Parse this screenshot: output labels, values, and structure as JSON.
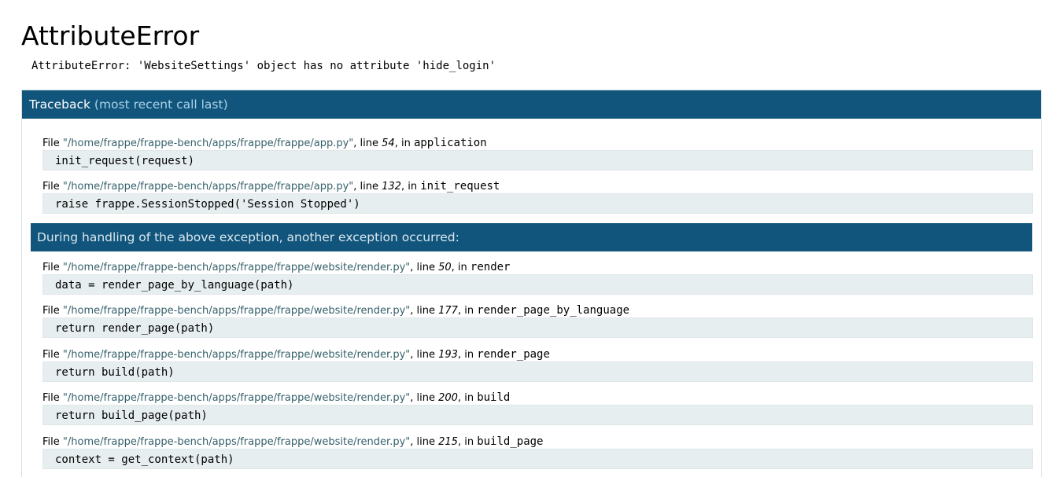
{
  "error": {
    "title": "AttributeError",
    "message": "AttributeError: 'WebsiteSettings' object has no attribute 'hide_login'"
  },
  "traceback": {
    "title": "Traceback",
    "subtitle": "(most recent call last)",
    "file_label": "File ",
    "line_label": ", line ",
    "in_label": ", in ",
    "frames_before": [
      {
        "file": "\"/home/frappe/frappe-bench/apps/frappe/frappe/app.py\"",
        "line": "54",
        "func": "application",
        "code": "init_request(request)"
      },
      {
        "file": "\"/home/frappe/frappe-bench/apps/frappe/frappe/app.py\"",
        "line": "132",
        "func": "init_request",
        "code": "raise frappe.SessionStopped('Session Stopped')"
      }
    ],
    "handling_text": "During handling of the above exception, another exception occurred:",
    "frames_after": [
      {
        "file": "\"/home/frappe/frappe-bench/apps/frappe/frappe/website/render.py\"",
        "line": "50",
        "func": "render",
        "code": "data = render_page_by_language(path)"
      },
      {
        "file": "\"/home/frappe/frappe-bench/apps/frappe/frappe/website/render.py\"",
        "line": "177",
        "func": "render_page_by_language",
        "code": "return render_page(path)"
      },
      {
        "file": "\"/home/frappe/frappe-bench/apps/frappe/frappe/website/render.py\"",
        "line": "193",
        "func": "render_page",
        "code": "return build(path)"
      },
      {
        "file": "\"/home/frappe/frappe-bench/apps/frappe/frappe/website/render.py\"",
        "line": "200",
        "func": "build",
        "code": "return build_page(path)"
      },
      {
        "file": "\"/home/frappe/frappe-bench/apps/frappe/frappe/website/render.py\"",
        "line": "215",
        "func": "build_page",
        "code": "context = get_context(path)"
      }
    ]
  },
  "colors": {
    "header_bg": "#11557c",
    "header_sub": "#a9d3ea",
    "code_bg": "#e7eef0",
    "file_link": "#35606a"
  }
}
